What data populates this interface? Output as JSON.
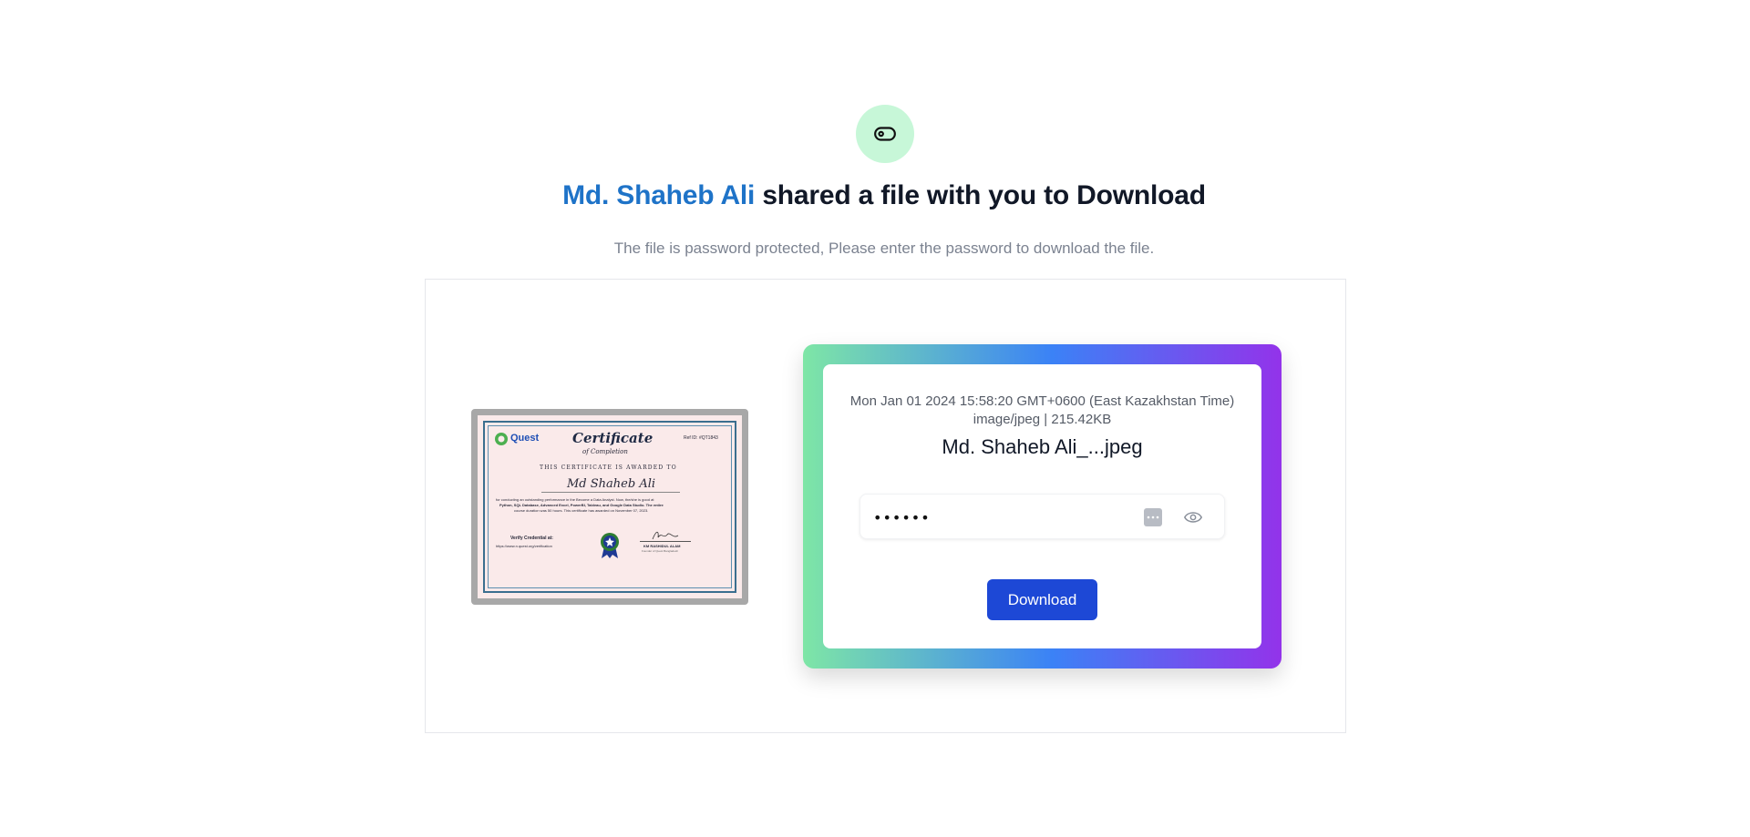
{
  "header": {
    "icon": "toggle-icon",
    "icon_bg": "#c7f7d8",
    "sender_name": "Md. Shaheb Ali",
    "headline_rest": " shared a file with you to Download",
    "subtitle": "The file is password protected, Please enter the password to download the file."
  },
  "preview": {
    "certificate": {
      "logo": "Quest",
      "title": "Certificate",
      "subtitle": "of Completion",
      "ref": "Ref ID: #QT1843",
      "awarded_line": "THIS CERTIFICATE IS AWARDED TO",
      "recipient": "Md Shaheb Ali",
      "body_1": "for conducting an outstanding performance in the Become a Data Analyst. Now, the/she is good at",
      "body_2": "Python, SQL Database, Advanced Excel, PowerBI, Tableau, and Google Data Studio. The entire",
      "body_3": "course duration was 50 hours. This certificate has awarded on November 07, 2023.",
      "verify_label": "Verify Credential at:",
      "verify_url": "https://www.n.quest.org/verification",
      "signer": "KM RASHIDUL ALAM",
      "signer_title": "Founder of Quest Bangladesh"
    }
  },
  "file": {
    "date": "Mon Jan 01 2024 15:58:20 GMT+0600 (East Kazakhstan Time)",
    "type_size": "image/jpeg | 215.42KB",
    "name": "Md. Shaheb Ali_...jpeg",
    "password_value": "••••••",
    "password_manager_icon": "password-manager-icon",
    "reveal_icon": "eye-icon",
    "download_label": "Download"
  },
  "colors": {
    "sender": "#1e73c8",
    "button": "#1d48d6",
    "gradient": [
      "#7ee6a6",
      "#3b82f6",
      "#9333ea"
    ]
  }
}
